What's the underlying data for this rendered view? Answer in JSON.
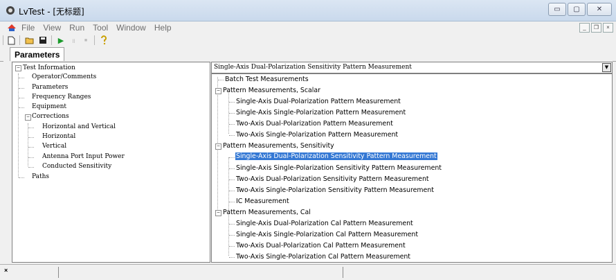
{
  "window": {
    "title": "LvTest - [无标题]"
  },
  "menu": [
    "File",
    "View",
    "Run",
    "Tool",
    "Window",
    "Help"
  ],
  "tabs": [
    {
      "label": "Parameters"
    }
  ],
  "left_tree": {
    "root": "Test Information",
    "items": [
      "Operator/Comments",
      "Parameters",
      "Frequency Ranges",
      "Equipment",
      "Corrections"
    ],
    "corrections_children": [
      "Horizontal and Vertical",
      "Horizontal",
      "Vertical",
      "Antenna Port Input Power",
      "Conducted Sensitivity"
    ],
    "tail": [
      "Paths"
    ]
  },
  "combo": {
    "value": "Single-Axis Dual-Polarization Sensitivity Pattern Measurement"
  },
  "right_tree": {
    "top_item": "Batch Test Measurements",
    "groups": [
      {
        "label": "Pattern Measurements, Scalar",
        "items": [
          "Single-Axis Dual-Polarization Pattern Measurement",
          "Single-Axis Single-Polarization Pattern Measurement",
          "Two-Axis Dual-Polarization Pattern Measurement",
          "Two-Axis Single-Polarization Pattern Measurement"
        ]
      },
      {
        "label": "Pattern Measurements, Sensitivity",
        "items": [
          "Single-Axis Dual-Polarization Sensitivity Pattern Measurement",
          "Single-Axis Single-Polarization Sensitivity Pattern Measurement",
          "Two-Axis Dual-Polarization Sensitivity Pattern Measurement",
          "Two-Axis Single-Polarization Sensitivity Pattern Measurement",
          "IC Measurement"
        ]
      },
      {
        "label": "Pattern Measurements, Cal",
        "items": [
          "Single-Axis Dual-Polarization Cal Pattern Measurement",
          "Single-Axis Single-Polarization Cal Pattern Measurement",
          "Two-Axis Dual-Polarization Cal Pattern Measurement",
          "Two-Axis Single-Polarization Cal Pattern Measurement"
        ]
      }
    ],
    "selected": "Single-Axis Dual-Polarization Sensitivity Pattern Measurement"
  },
  "statusbar": {
    "close_glyph": "×"
  },
  "colors": {
    "selection": "#3478d4",
    "titlebar": "#c9d9ec",
    "run_green": "#1a9a2a"
  }
}
